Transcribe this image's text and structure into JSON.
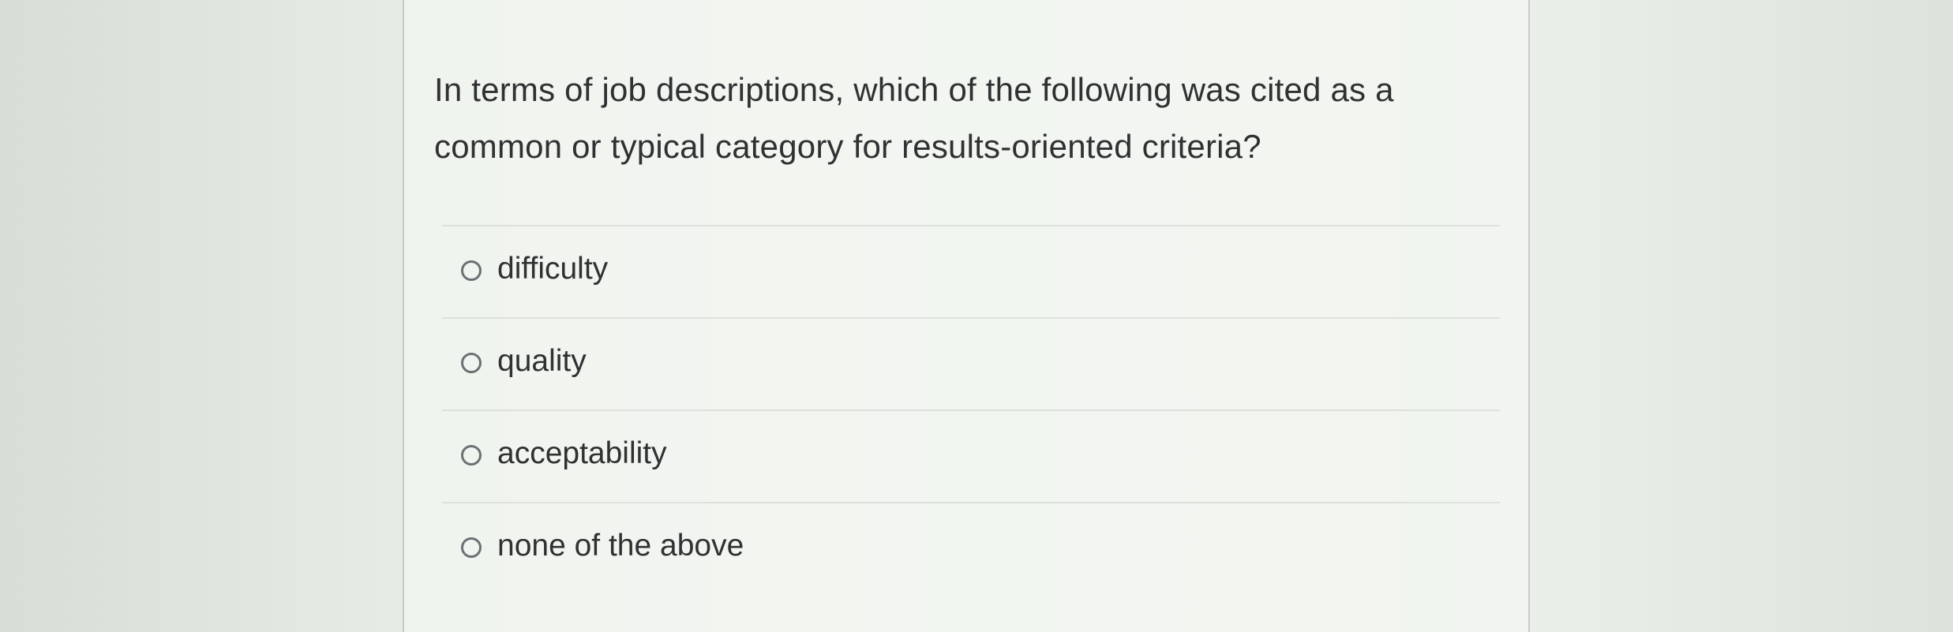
{
  "question": {
    "text": "In terms of job descriptions, which of the following was cited as a common or typical category for results-oriented criteria?"
  },
  "answers": [
    {
      "label": "difficulty"
    },
    {
      "label": "quality"
    },
    {
      "label": "acceptability"
    },
    {
      "label": "none of the above"
    }
  ],
  "colors": {
    "text": "#2f3132",
    "radio_border": "#6c7073",
    "divider": "#dde1dc",
    "card_border": "#c8ccc6"
  }
}
